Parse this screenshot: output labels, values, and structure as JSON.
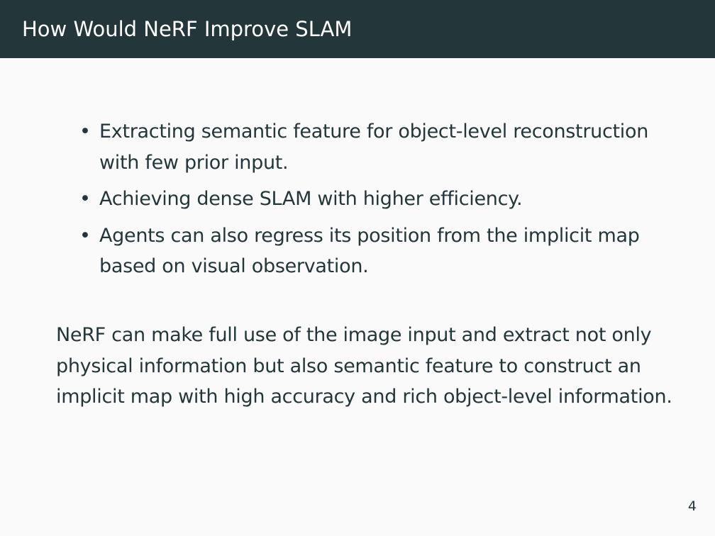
{
  "slide": {
    "title": "How Would NeRF Improve SLAM",
    "bullet_marker": "•",
    "bullets": [
      "Extracting semantic feature for object-level reconstruction with few prior input.",
      "Achieving dense SLAM with higher efficiency.",
      "Agents can also regress its position from the implicit map based on visual observation."
    ],
    "paragraph": "NeRF can make full use of the image input and extract not only physical information but also semantic feature to construct an implicit map with high accuracy and rich object-level information.",
    "page_number": "4"
  },
  "colors": {
    "title_bar": "#23373b",
    "title_text": "#ffffff",
    "background": "#fafafa",
    "body_text": "#23373b"
  }
}
